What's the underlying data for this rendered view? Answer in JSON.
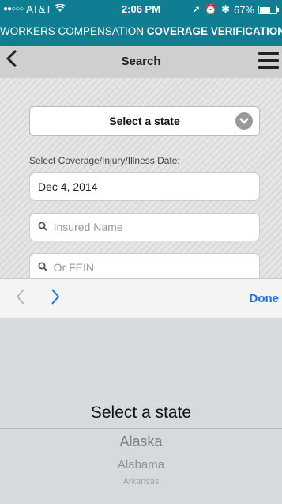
{
  "status": {
    "signal": "●●○○○",
    "carrier": "AT&T",
    "wifi_icon": "wifi-icon",
    "time": "2:06 PM",
    "battery": "67%",
    "battery_level": 0.67
  },
  "header": {
    "title_light": "WORKERS COMPENSATION ",
    "title_bold": "COVERAGE VERIFICATION"
  },
  "navbar": {
    "title": "Search",
    "back_icon": "chevron-left-icon",
    "menu_icon": "hamburger-menu-icon"
  },
  "form": {
    "state_select": {
      "value": "Select a state"
    },
    "date_label": "Select Coverage/Injury/Illness Date:",
    "date_value": "Dec 4, 2014",
    "insured_name_placeholder": "Insured Name",
    "fein_placeholder": "Or FEIN"
  },
  "accessory": {
    "done_label": "Done"
  },
  "picker": {
    "selected": "Select a state",
    "options": [
      "Alaska",
      "Alabama",
      "Arkansas"
    ]
  },
  "colors": {
    "brand": "#0f7e93",
    "accent": "#1a73e8"
  }
}
